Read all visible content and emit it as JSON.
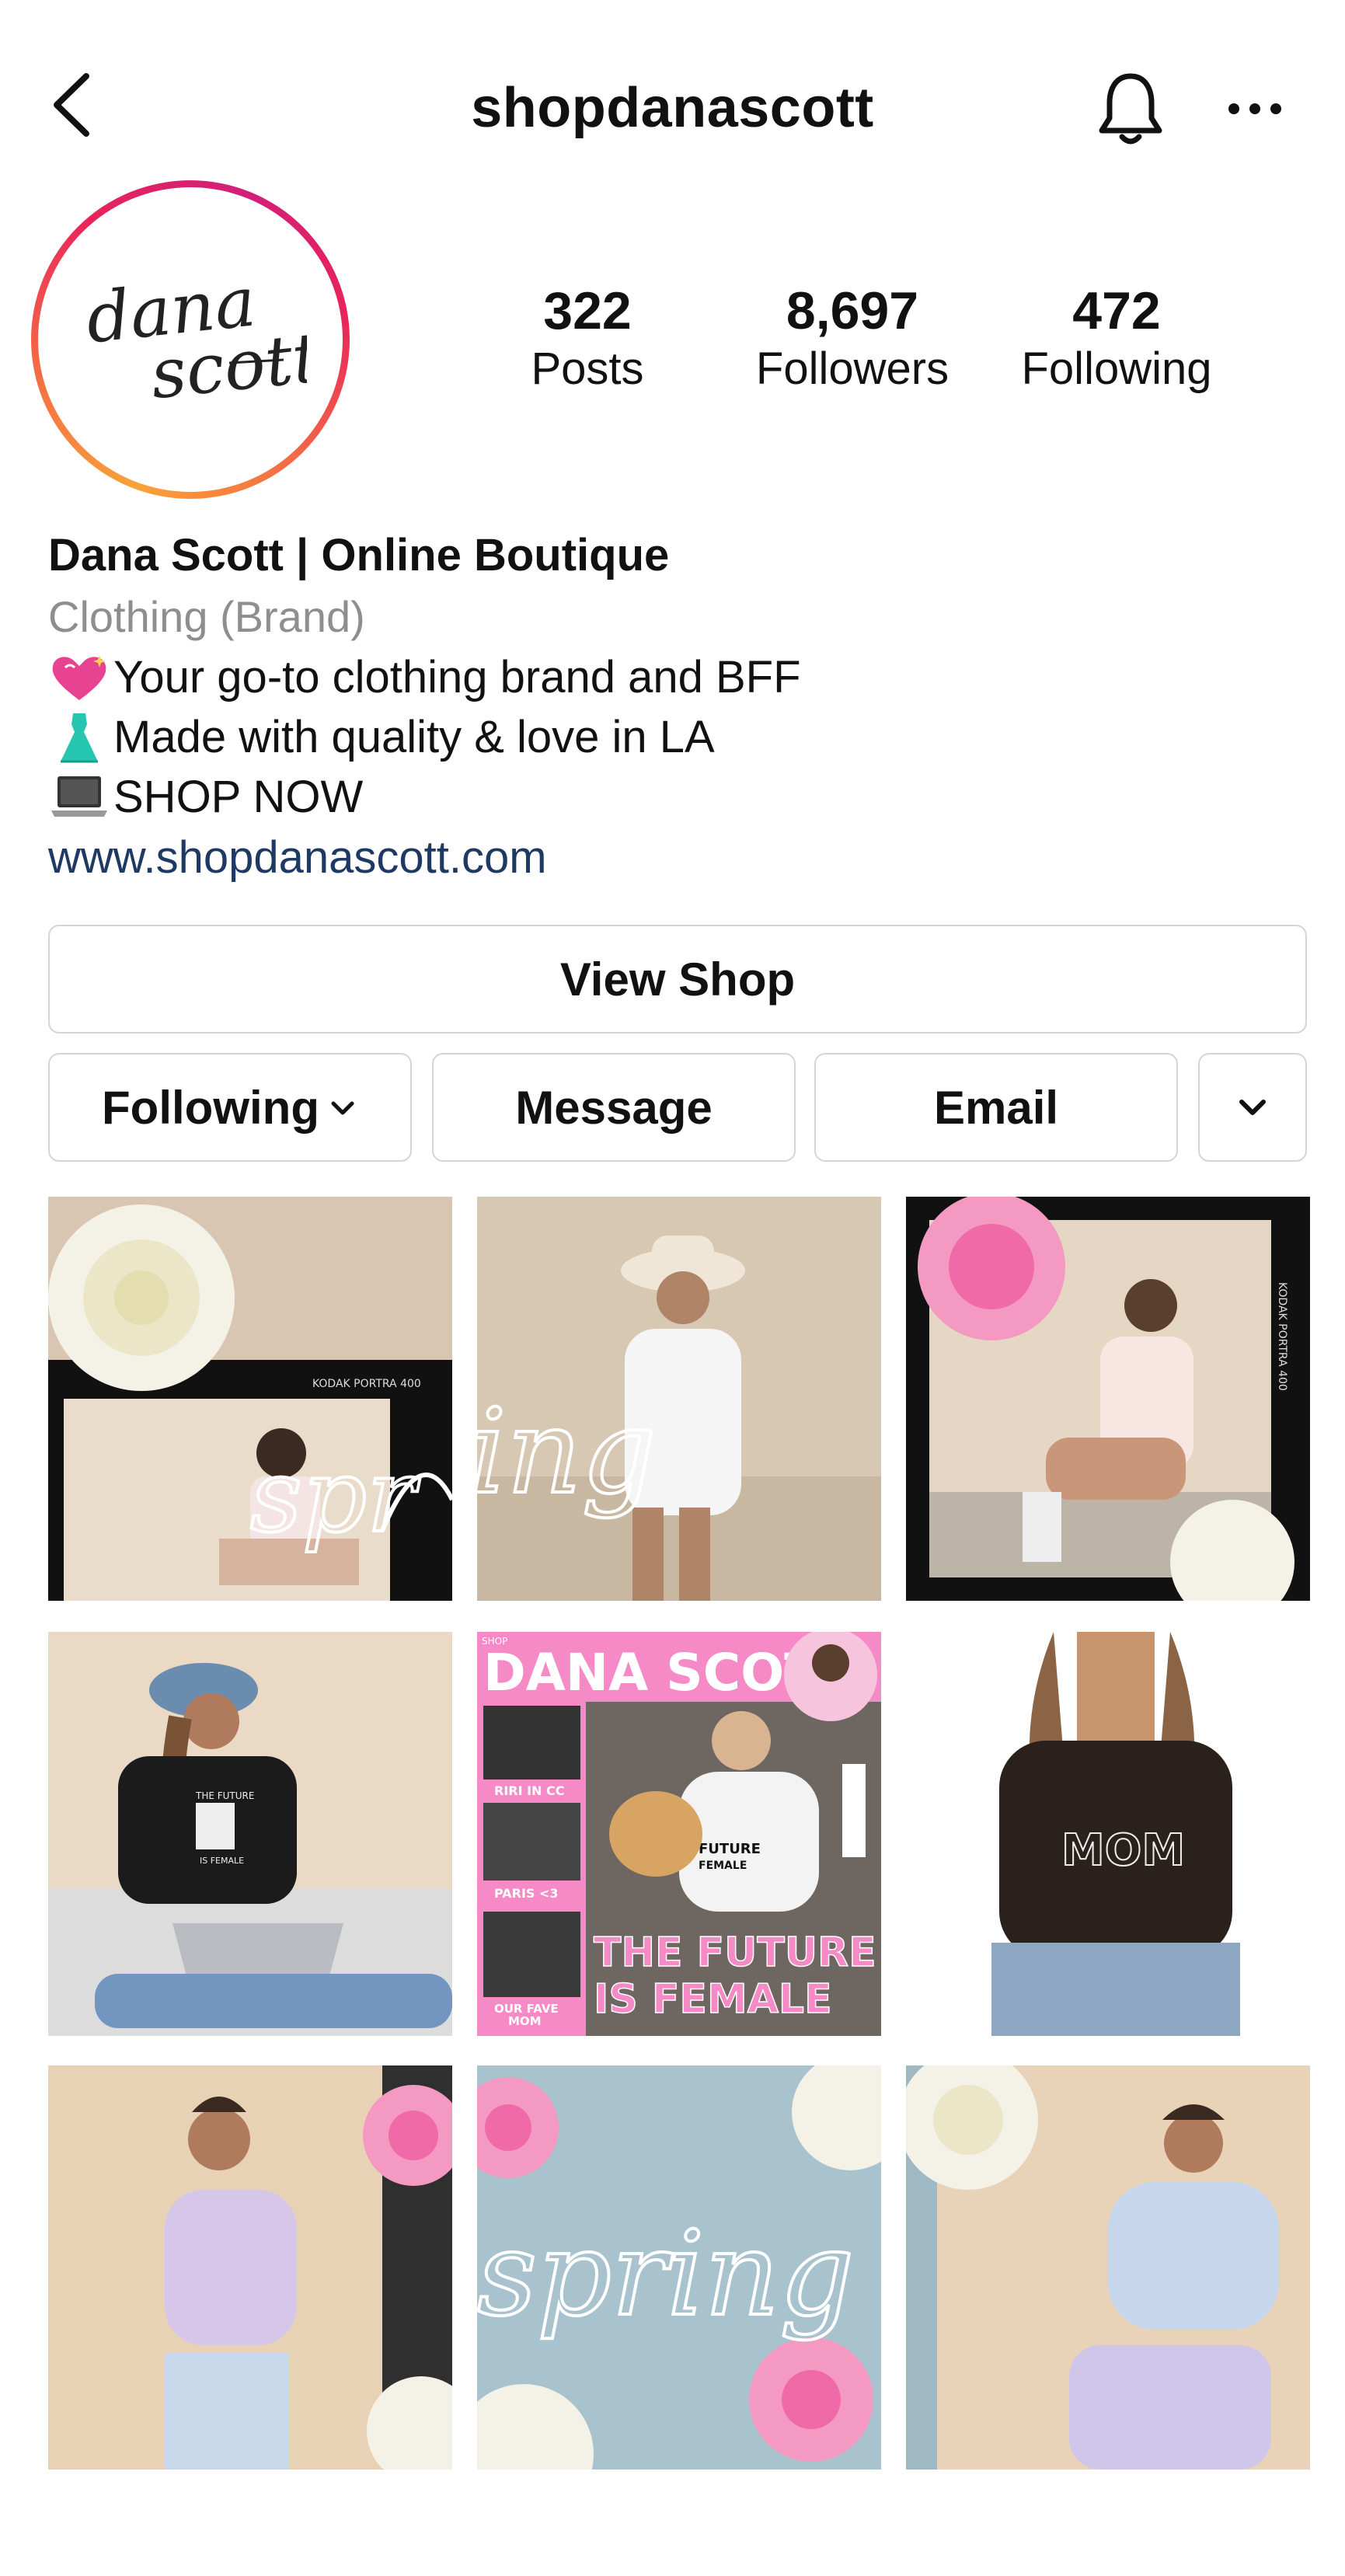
{
  "header": {
    "username": "shopdanascott"
  },
  "profile": {
    "avatar_text": "dana scott",
    "stats": [
      {
        "value": "322",
        "label": "Posts"
      },
      {
        "value": "8,697",
        "label": "Followers"
      },
      {
        "value": "472",
        "label": "Following"
      }
    ],
    "name": "Dana Scott | Online Boutique",
    "category": "Clothing (Brand)",
    "bio_lines": [
      {
        "icon": "sparkling-heart-icon",
        "text": "Your go-to clothing brand and BFF"
      },
      {
        "icon": "dress-icon",
        "text": "Made with quality & love in LA"
      },
      {
        "icon": "laptop-icon",
        "text": " SHOP NOW"
      }
    ],
    "website": "www.shopdanascott.com"
  },
  "actions": {
    "view_shop": "View Shop",
    "following": "Following",
    "message": "Message",
    "email": "Email"
  },
  "grid": {
    "posts": [
      {
        "id": "post-1",
        "overlay": "spring"
      },
      {
        "id": "post-2",
        "overlay": "spring"
      },
      {
        "id": "post-3",
        "overlay": ""
      },
      {
        "id": "post-4",
        "shirt_text": "THE FUTURE IS FEMALE"
      },
      {
        "id": "post-5",
        "magazine_title": "DANA SCOTT",
        "captions": [
          "RIRI IN CC",
          "PARIS <3",
          "OUR FAVE MOM"
        ],
        "headline": "THE FUTURE IS FEMALE",
        "shirt_text": "FUTURE FEMALE",
        "shop_label": "SHOP"
      },
      {
        "id": "post-6",
        "shirt_text": "MOM"
      },
      {
        "id": "post-7",
        "overlay": ""
      },
      {
        "id": "post-8",
        "overlay": "spring"
      },
      {
        "id": "post-9",
        "overlay": ""
      }
    ],
    "film_text": "KODAK PORTRA 400"
  },
  "colors": {
    "link": "#1e3a64",
    "category": "#8e8e8e",
    "ring_start": "#f9a23a",
    "ring_end": "#d21f7a",
    "magazine_pink": "#f58ac6"
  }
}
